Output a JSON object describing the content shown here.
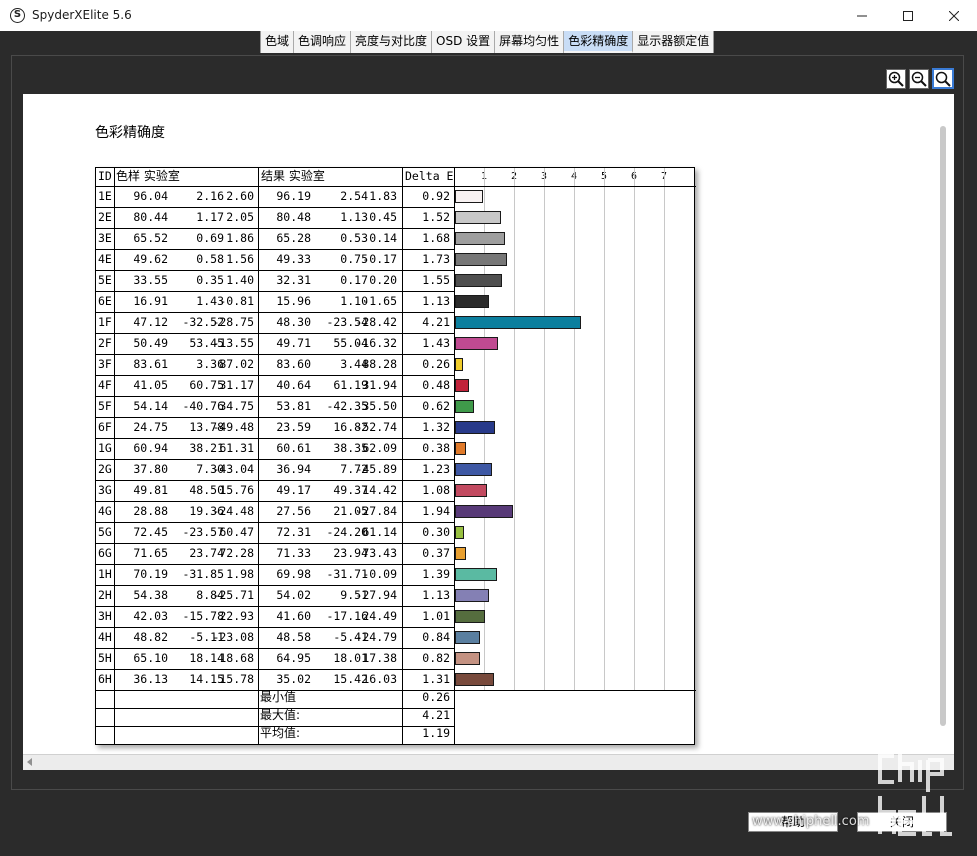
{
  "window": {
    "title": "SpyderXElite 5.6",
    "icon_letter": "S"
  },
  "tabs": [
    {
      "label": "色域"
    },
    {
      "label": "色调响应"
    },
    {
      "label": "亮度与对比度"
    },
    {
      "label": "OSD 设置"
    },
    {
      "label": "屏幕均匀性"
    },
    {
      "label": "色彩精确度"
    },
    {
      "label": "显示器额定值"
    }
  ],
  "report": {
    "title": "色彩精确度",
    "headers": {
      "id": "ID",
      "sample": "色样 实验室",
      "result": "结果 实验室",
      "delta": "Delta E"
    },
    "rows": [
      {
        "id": "1E",
        "s": [
          "96.04",
          "2.16",
          "2.60"
        ],
        "r": [
          "96.19",
          "2.54",
          "1.83"
        ],
        "d": "0.92",
        "dv": 0.92,
        "color": "#f8f2f2"
      },
      {
        "id": "2E",
        "s": [
          "80.44",
          "1.17",
          "2.05"
        ],
        "r": [
          "80.48",
          "1.13",
          "0.45"
        ],
        "d": "1.52",
        "dv": 1.52,
        "color": "#c8c8c8"
      },
      {
        "id": "3E",
        "s": [
          "65.52",
          "0.69",
          "1.86"
        ],
        "r": [
          "65.28",
          "0.53",
          "0.14"
        ],
        "d": "1.68",
        "dv": 1.68,
        "color": "#9e9e9e"
      },
      {
        "id": "4E",
        "s": [
          "49.62",
          "0.58",
          "1.56"
        ],
        "r": [
          "49.33",
          "0.75",
          "-0.17"
        ],
        "d": "1.73",
        "dv": 1.73,
        "color": "#777777"
      },
      {
        "id": "5E",
        "s": [
          "33.55",
          "0.35",
          "1.40"
        ],
        "r": [
          "32.31",
          "0.17",
          "0.20"
        ],
        "d": "1.55",
        "dv": 1.55,
        "color": "#4f4f4f"
      },
      {
        "id": "6E",
        "s": [
          "16.91",
          "1.43",
          "-0.81"
        ],
        "r": [
          "15.96",
          "1.10",
          "-1.65"
        ],
        "d": "1.13",
        "dv": 1.13,
        "color": "#2b2b2b"
      },
      {
        "id": "1F",
        "s": [
          "47.12",
          "-32.52",
          "-28.75"
        ],
        "r": [
          "48.30",
          "-23.54",
          "-28.42"
        ],
        "d": "4.21",
        "dv": 4.21,
        "color": "#0b7f9e"
      },
      {
        "id": "2F",
        "s": [
          "50.49",
          "53.45",
          "-13.55"
        ],
        "r": [
          "49.71",
          "55.04",
          "-16.32"
        ],
        "d": "1.43",
        "dv": 1.43,
        "color": "#c04a91"
      },
      {
        "id": "3F",
        "s": [
          "83.61",
          "3.36",
          "87.02"
        ],
        "r": [
          "83.60",
          "3.44",
          "88.28"
        ],
        "d": "0.26",
        "dv": 0.26,
        "color": "#f0cc2a"
      },
      {
        "id": "4F",
        "s": [
          "41.05",
          "60.75",
          "31.17"
        ],
        "r": [
          "40.64",
          "61.19",
          "31.94"
        ],
        "d": "0.48",
        "dv": 0.48,
        "color": "#c0223a"
      },
      {
        "id": "5F",
        "s": [
          "54.14",
          "-40.76",
          "34.75"
        ],
        "r": [
          "53.81",
          "-42.35",
          "35.50"
        ],
        "d": "0.62",
        "dv": 0.62,
        "color": "#3f9a4a"
      },
      {
        "id": "6F",
        "s": [
          "24.75",
          "13.78",
          "-49.48"
        ],
        "r": [
          "23.59",
          "16.82",
          "-52.74"
        ],
        "d": "1.32",
        "dv": 1.32,
        "color": "#283a8a"
      },
      {
        "id": "1G",
        "s": [
          "60.94",
          "38.21",
          "61.31"
        ],
        "r": [
          "60.61",
          "38.35",
          "62.09"
        ],
        "d": "0.38",
        "dv": 0.38,
        "color": "#e07a2a"
      },
      {
        "id": "2G",
        "s": [
          "37.80",
          "7.30",
          "-43.04"
        ],
        "r": [
          "36.94",
          "7.72",
          "-45.89"
        ],
        "d": "1.23",
        "dv": 1.23,
        "color": "#3e58a4"
      },
      {
        "id": "3G",
        "s": [
          "49.81",
          "48.50",
          "15.76"
        ],
        "r": [
          "49.17",
          "49.37",
          "14.42"
        ],
        "d": "1.08",
        "dv": 1.08,
        "color": "#c24a60"
      },
      {
        "id": "4G",
        "s": [
          "28.88",
          "19.36",
          "-24.48"
        ],
        "r": [
          "27.56",
          "21.05",
          "-27.84"
        ],
        "d": "1.94",
        "dv": 1.94,
        "color": "#583a78"
      },
      {
        "id": "5G",
        "s": [
          "72.45",
          "-23.57",
          "60.47"
        ],
        "r": [
          "72.31",
          "-24.20",
          "61.14"
        ],
        "d": "0.30",
        "dv": 0.3,
        "color": "#98c040"
      },
      {
        "id": "6G",
        "s": [
          "71.65",
          "23.74",
          "72.28"
        ],
        "r": [
          "71.33",
          "23.94",
          "73.43"
        ],
        "d": "0.37",
        "dv": 0.37,
        "color": "#e9a030"
      },
      {
        "id": "1H",
        "s": [
          "70.19",
          "-31.85",
          "1.98"
        ],
        "r": [
          "69.98",
          "-31.71",
          "-0.09"
        ],
        "d": "1.39",
        "dv": 1.39,
        "color": "#5abaa2"
      },
      {
        "id": "2H",
        "s": [
          "54.38",
          "8.84",
          "-25.71"
        ],
        "r": [
          "54.02",
          "9.51",
          "-27.94"
        ],
        "d": "1.13",
        "dv": 1.13,
        "color": "#8480b4"
      },
      {
        "id": "3H",
        "s": [
          "42.03",
          "-15.78",
          "22.93"
        ],
        "r": [
          "41.60",
          "-17.16",
          "24.49"
        ],
        "d": "1.01",
        "dv": 1.01,
        "color": "#556d3e"
      },
      {
        "id": "4H",
        "s": [
          "48.82",
          "-5.11",
          "-23.08"
        ],
        "r": [
          "48.58",
          "-5.41",
          "-24.79"
        ],
        "d": "0.84",
        "dv": 0.84,
        "color": "#5a7fa0"
      },
      {
        "id": "5H",
        "s": [
          "65.10",
          "18.14",
          "18.68"
        ],
        "r": [
          "64.95",
          "18.01",
          "17.38"
        ],
        "d": "0.82",
        "dv": 0.82,
        "color": "#c49282"
      },
      {
        "id": "6H",
        "s": [
          "36.13",
          "14.15",
          "15.78"
        ],
        "r": [
          "35.02",
          "15.42",
          "16.03"
        ],
        "d": "1.31",
        "dv": 1.31,
        "color": "#784a3c"
      }
    ],
    "summary": [
      {
        "label": "最小值",
        "value": "0.26"
      },
      {
        "label": "最大值:",
        "value": "4.21"
      },
      {
        "label": "平均值:",
        "value": "1.19"
      }
    ],
    "axis_ticks": [
      "1",
      "2",
      "3",
      "4",
      "5",
      "6",
      "7"
    ],
    "axis_max": 8
  },
  "buttons": [
    {
      "label": "帮助"
    },
    {
      "label": "关闭"
    }
  ],
  "watermark": "www.chiphell.com",
  "watermark_logo": "chip hell"
}
